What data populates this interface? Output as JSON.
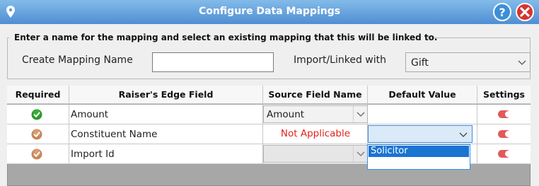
{
  "window": {
    "title": "Configure  Data Mappings",
    "help_icon": "help-icon",
    "close_icon": "close-icon",
    "pin_icon": "pin-icon",
    "accent": "#4f8ed3"
  },
  "form": {
    "instruction": "Enter a name for the mapping and select an existing mapping that this will be linked to.",
    "create_name_label": "Create Mapping Name",
    "create_name_value": "",
    "import_label": "Import/Linked with",
    "import_value": "Gift"
  },
  "table": {
    "headers": [
      "Required",
      "Raiser's Edge Field",
      "Source Field Name",
      "Default Value",
      "Settings"
    ],
    "rows": [
      {
        "status": "green-check",
        "field": "Amount",
        "source": "Amount",
        "default": "",
        "setting_icon": "toggle-icon"
      },
      {
        "status": "orange-check",
        "field": "Constituent Name",
        "source": "Not Applicable",
        "default": "",
        "setting_icon": "toggle-icon"
      },
      {
        "status": "orange-check",
        "field": "Import  Id",
        "source": "",
        "default": "",
        "setting_icon": "toggle-icon"
      }
    ],
    "open_dropdown": {
      "options": [
        "Solicitor",
        ""
      ],
      "selected": "Solicitor"
    }
  },
  "colors": {
    "status_green": "#2a9a2a",
    "status_orange": "#c8865a",
    "not_applicable": "#e2231a",
    "toggle": "#e05a5a",
    "selection": "#1a74d1"
  }
}
